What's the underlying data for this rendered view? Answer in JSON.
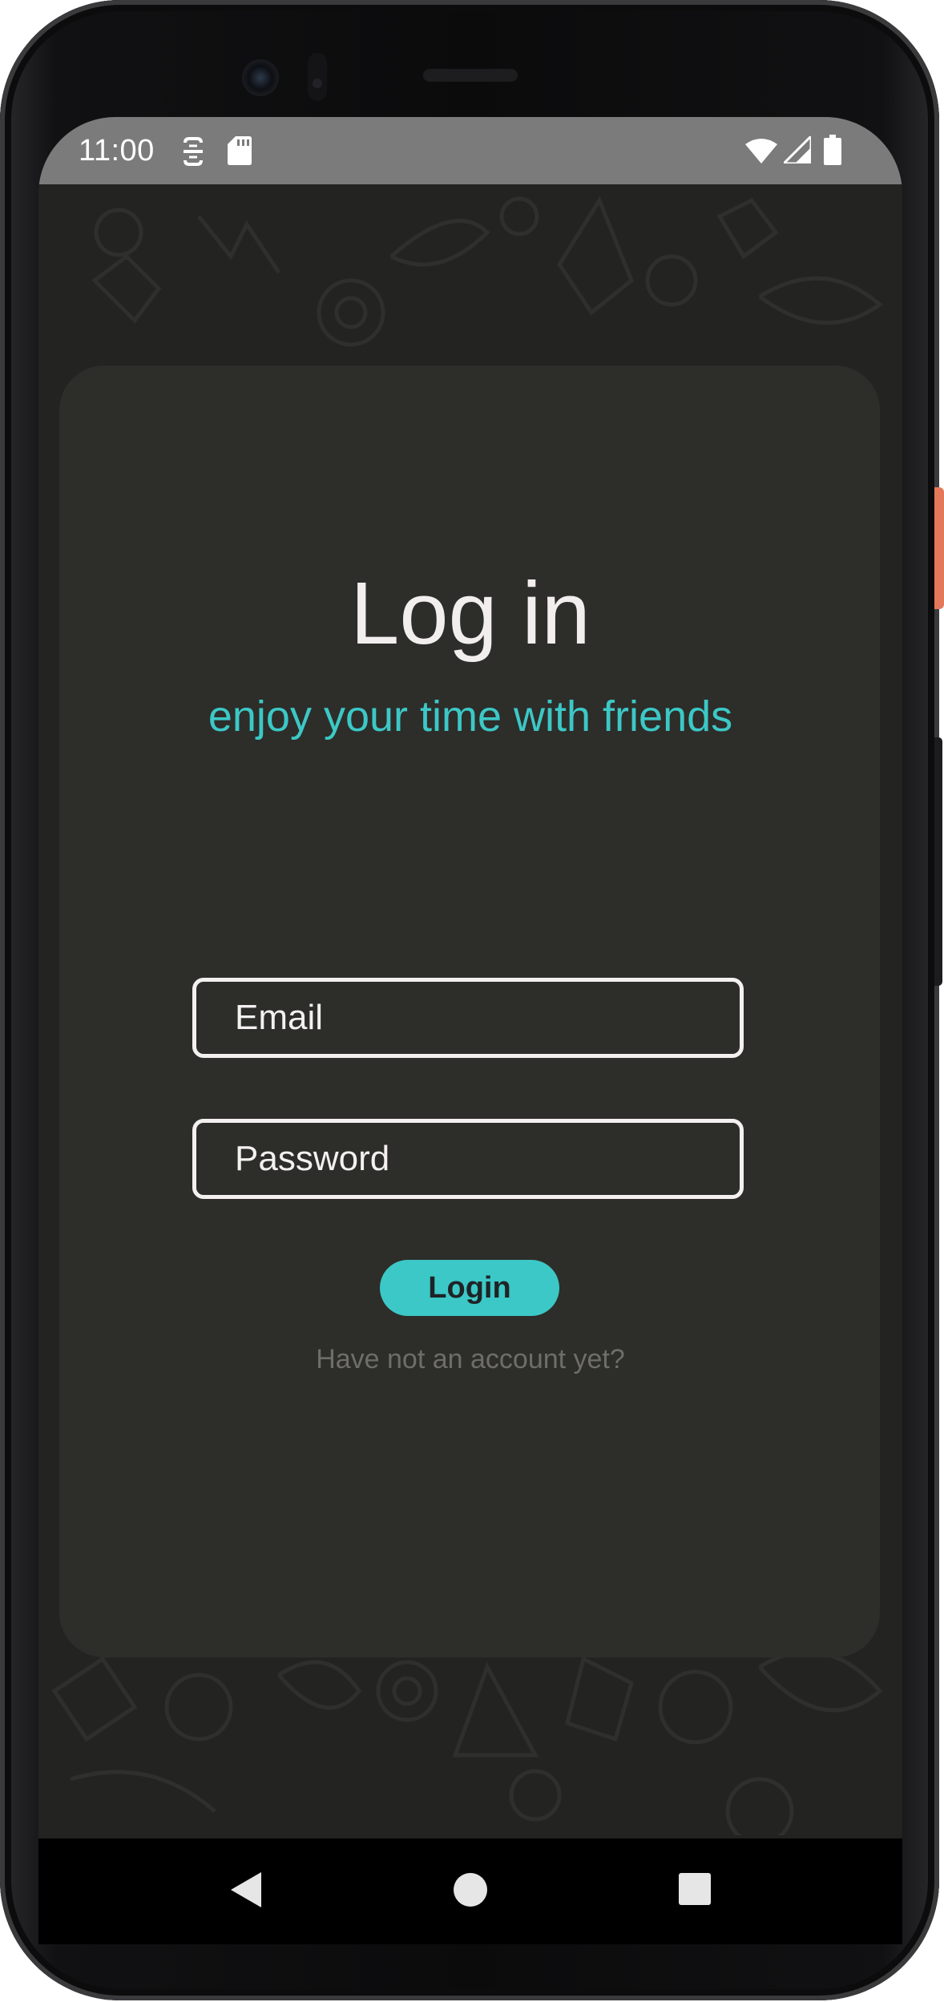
{
  "statusbar": {
    "time": "11:00",
    "left_icons": [
      "data-saver-icon",
      "sd-card-icon"
    ],
    "right_icons": [
      "wifi-icon",
      "cell-signal-icon",
      "battery-icon"
    ]
  },
  "login": {
    "title": "Log in",
    "subtitle": "enjoy your time with friends",
    "email_placeholder": "Email",
    "password_placeholder": "Password",
    "login_label": "Login",
    "signup_link": "Have not an account yet?"
  },
  "navbar": {
    "icons": [
      "back-icon",
      "home-icon",
      "recents-icon"
    ]
  },
  "colors": {
    "accent": "#3cc8c6",
    "background": "#222220",
    "card": "#2d2d2a",
    "statusbar": "#7b7b7b",
    "text": "#f2eeee",
    "muted": "#6e6d69"
  }
}
